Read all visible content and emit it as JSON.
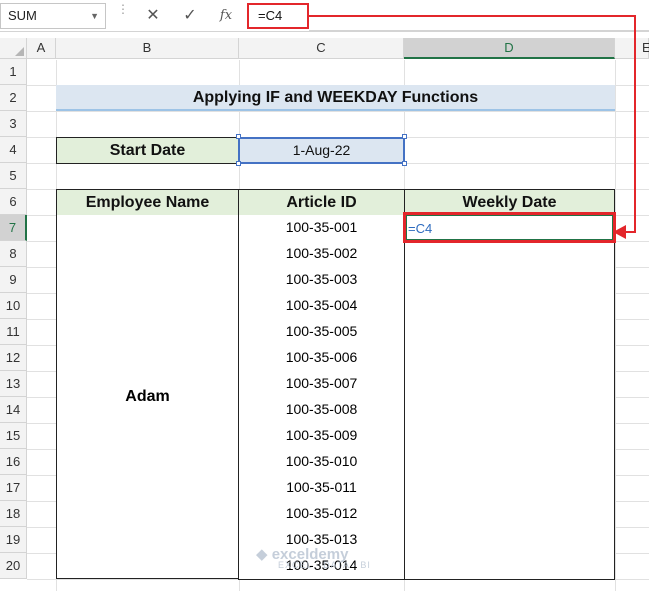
{
  "formula_bar": {
    "name_box": "SUM",
    "cancel_glyph": "✕",
    "enter_glyph": "✓",
    "fx_glyph": "fx",
    "formula": "=C4"
  },
  "columns": [
    "A",
    "B",
    "C",
    "D",
    "E"
  ],
  "rows": [
    "1",
    "2",
    "3",
    "4",
    "5",
    "6",
    "7",
    "8",
    "9",
    "10",
    "11",
    "12",
    "13",
    "14",
    "15",
    "16",
    "17",
    "18",
    "19",
    "20"
  ],
  "sheet": {
    "title": "Applying IF and WEEKDAY Functions",
    "start_date_label": "Start Date",
    "start_date_value": "1-Aug-22",
    "table_headers": [
      "Employee Name",
      "Article ID",
      "Weekly Date"
    ],
    "employee": "Adam",
    "article_ids": [
      "100-35-001",
      "100-35-002",
      "100-35-003",
      "100-35-004",
      "100-35-005",
      "100-35-006",
      "100-35-007",
      "100-35-008",
      "100-35-009",
      "100-35-010",
      "100-35-011",
      "100-35-012",
      "100-35-013",
      "100-35-014"
    ],
    "editing_cell_text": "=C4"
  },
  "watermark": {
    "brand": "exceldemy",
    "tagline": "EXCEL · DATA · BI"
  },
  "colors": {
    "accent_red": "#e3262b",
    "excel_green": "#217346",
    "header_fill": "#e2efda",
    "title_fill": "#dce6f1"
  }
}
